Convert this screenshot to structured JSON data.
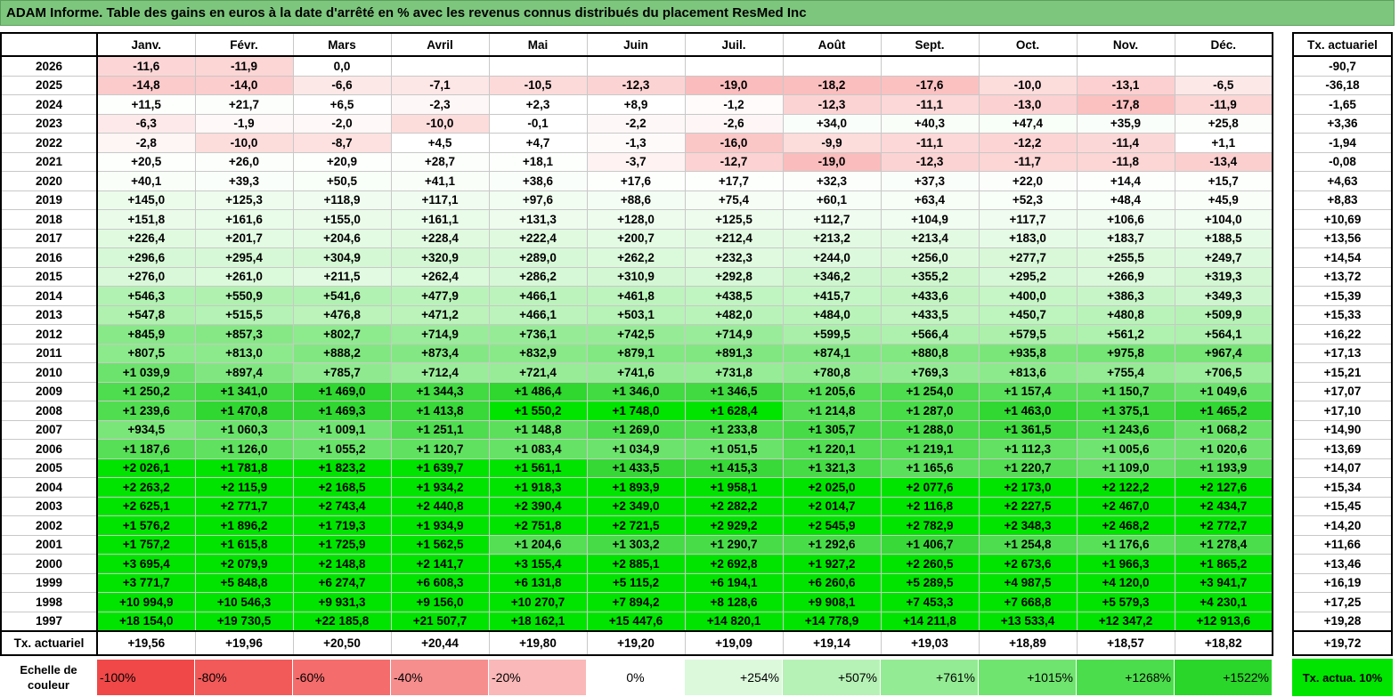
{
  "title": "ADAM Informe. Table des gains en euros à la date d'arrêté en % avec les revenus connus distribués du placement ResMed Inc",
  "months": [
    "Janv.",
    "Févr.",
    "Mars",
    "Avril",
    "Mai",
    "Juin",
    "Juil.",
    "Août",
    "Sept.",
    "Oct.",
    "Nov.",
    "Déc."
  ],
  "rate_header": "Tx. actuariel",
  "rows": [
    {
      "year": "2026",
      "values": [
        "-11,6",
        "-11,9",
        "0,0",
        "",
        "",
        "",
        "",
        "",
        "",
        "",
        "",
        ""
      ],
      "rate": "-90,7"
    },
    {
      "year": "2025",
      "values": [
        "-14,8",
        "-14,0",
        "-6,6",
        "-7,1",
        "-10,5",
        "-12,3",
        "-19,0",
        "-18,2",
        "-17,6",
        "-10,0",
        "-13,1",
        "-6,5"
      ],
      "rate": "-36,18"
    },
    {
      "year": "2024",
      "values": [
        "+11,5",
        "+21,7",
        "+6,5",
        "-2,3",
        "+2,3",
        "+8,9",
        "-1,2",
        "-12,3",
        "-11,1",
        "-13,0",
        "-17,8",
        "-11,9"
      ],
      "rate": "-1,65"
    },
    {
      "year": "2023",
      "values": [
        "-6,3",
        "-1,9",
        "-2,0",
        "-10,0",
        "-0,1",
        "-2,2",
        "-2,6",
        "+34,0",
        "+40,3",
        "+47,4",
        "+35,9",
        "+25,8"
      ],
      "rate": "+3,36"
    },
    {
      "year": "2022",
      "values": [
        "-2,8",
        "-10,0",
        "-8,7",
        "+4,5",
        "+4,7",
        "-1,3",
        "-16,0",
        "-9,9",
        "-11,1",
        "-12,2",
        "-11,4",
        "+1,1"
      ],
      "rate": "-1,94"
    },
    {
      "year": "2021",
      "values": [
        "+20,5",
        "+26,0",
        "+20,9",
        "+28,7",
        "+18,1",
        "-3,7",
        "-12,7",
        "-19,0",
        "-12,3",
        "-11,7",
        "-11,8",
        "-13,4"
      ],
      "rate": "-0,08"
    },
    {
      "year": "2020",
      "values": [
        "+40,1",
        "+39,3",
        "+50,5",
        "+41,1",
        "+38,6",
        "+17,6",
        "+17,7",
        "+32,3",
        "+37,3",
        "+22,0",
        "+14,4",
        "+15,7"
      ],
      "rate": "+4,63"
    },
    {
      "year": "2019",
      "values": [
        "+145,0",
        "+125,3",
        "+118,9",
        "+117,1",
        "+97,6",
        "+88,6",
        "+75,4",
        "+60,1",
        "+63,4",
        "+52,3",
        "+48,4",
        "+45,9"
      ],
      "rate": "+8,83"
    },
    {
      "year": "2018",
      "values": [
        "+151,8",
        "+161,6",
        "+155,0",
        "+161,1",
        "+131,3",
        "+128,0",
        "+125,5",
        "+112,7",
        "+104,9",
        "+117,7",
        "+106,6",
        "+104,0"
      ],
      "rate": "+10,69"
    },
    {
      "year": "2017",
      "values": [
        "+226,4",
        "+201,7",
        "+204,6",
        "+228,4",
        "+222,4",
        "+200,7",
        "+212,4",
        "+213,2",
        "+213,4",
        "+183,0",
        "+183,7",
        "+188,5"
      ],
      "rate": "+13,56"
    },
    {
      "year": "2016",
      "values": [
        "+296,6",
        "+295,4",
        "+304,9",
        "+320,9",
        "+289,0",
        "+262,2",
        "+232,3",
        "+244,0",
        "+256,0",
        "+277,7",
        "+255,5",
        "+249,7"
      ],
      "rate": "+14,54"
    },
    {
      "year": "2015",
      "values": [
        "+276,0",
        "+261,0",
        "+211,5",
        "+262,4",
        "+286,2",
        "+310,9",
        "+292,8",
        "+346,2",
        "+355,2",
        "+295,2",
        "+266,9",
        "+319,3"
      ],
      "rate": "+13,72"
    },
    {
      "year": "2014",
      "values": [
        "+546,3",
        "+550,9",
        "+541,6",
        "+477,9",
        "+466,1",
        "+461,8",
        "+438,5",
        "+415,7",
        "+433,6",
        "+400,0",
        "+386,3",
        "+349,3"
      ],
      "rate": "+15,39"
    },
    {
      "year": "2013",
      "values": [
        "+547,8",
        "+515,5",
        "+476,8",
        "+471,2",
        "+466,1",
        "+503,1",
        "+482,0",
        "+484,0",
        "+433,5",
        "+450,7",
        "+480,8",
        "+509,9"
      ],
      "rate": "+15,33"
    },
    {
      "year": "2012",
      "values": [
        "+845,9",
        "+857,3",
        "+802,7",
        "+714,9",
        "+736,1",
        "+742,5",
        "+714,9",
        "+599,5",
        "+566,4",
        "+579,5",
        "+561,2",
        "+564,1"
      ],
      "rate": "+16,22"
    },
    {
      "year": "2011",
      "values": [
        "+807,5",
        "+813,0",
        "+888,2",
        "+873,4",
        "+832,9",
        "+879,1",
        "+891,3",
        "+874,1",
        "+880,8",
        "+935,8",
        "+975,8",
        "+967,4"
      ],
      "rate": "+17,13"
    },
    {
      "year": "2010",
      "values": [
        "+1 039,9",
        "+897,4",
        "+785,7",
        "+712,4",
        "+721,4",
        "+741,6",
        "+731,8",
        "+780,8",
        "+769,3",
        "+813,6",
        "+755,4",
        "+706,5"
      ],
      "rate": "+15,21"
    },
    {
      "year": "2009",
      "values": [
        "+1 250,2",
        "+1 341,0",
        "+1 469,0",
        "+1 344,3",
        "+1 486,4",
        "+1 346,0",
        "+1 346,5",
        "+1 205,6",
        "+1 254,0",
        "+1 157,4",
        "+1 150,7",
        "+1 049,6"
      ],
      "rate": "+17,07"
    },
    {
      "year": "2008",
      "values": [
        "+1 239,6",
        "+1 470,8",
        "+1 469,3",
        "+1 413,8",
        "+1 550,2",
        "+1 748,0",
        "+1 628,4",
        "+1 214,8",
        "+1 287,0",
        "+1 463,0",
        "+1 375,1",
        "+1 465,2"
      ],
      "rate": "+17,10"
    },
    {
      "year": "2007",
      "values": [
        "+934,5",
        "+1 060,3",
        "+1 009,1",
        "+1 251,1",
        "+1 148,8",
        "+1 269,0",
        "+1 233,8",
        "+1 305,7",
        "+1 288,0",
        "+1 361,5",
        "+1 243,6",
        "+1 068,2"
      ],
      "rate": "+14,90"
    },
    {
      "year": "2006",
      "values": [
        "+1 187,6",
        "+1 126,0",
        "+1 055,2",
        "+1 120,7",
        "+1 083,4",
        "+1 034,9",
        "+1 051,5",
        "+1 220,1",
        "+1 219,1",
        "+1 112,3",
        "+1 005,6",
        "+1 020,6"
      ],
      "rate": "+13,69"
    },
    {
      "year": "2005",
      "values": [
        "+2 026,1",
        "+1 781,8",
        "+1 823,2",
        "+1 639,7",
        "+1 561,1",
        "+1 433,5",
        "+1 415,3",
        "+1 321,3",
        "+1 165,6",
        "+1 220,7",
        "+1 109,0",
        "+1 193,9"
      ],
      "rate": "+14,07"
    },
    {
      "year": "2004",
      "values": [
        "+2 263,2",
        "+2 115,9",
        "+2 168,5",
        "+1 934,2",
        "+1 918,3",
        "+1 893,9",
        "+1 958,1",
        "+2 025,0",
        "+2 077,6",
        "+2 173,0",
        "+2 122,2",
        "+2 127,6"
      ],
      "rate": "+15,34"
    },
    {
      "year": "2003",
      "values": [
        "+2 625,1",
        "+2 771,7",
        "+2 743,4",
        "+2 440,8",
        "+2 390,4",
        "+2 349,0",
        "+2 282,2",
        "+2 014,7",
        "+2 116,8",
        "+2 227,5",
        "+2 467,0",
        "+2 434,7"
      ],
      "rate": "+15,45"
    },
    {
      "year": "2002",
      "values": [
        "+1 576,2",
        "+1 896,2",
        "+1 719,3",
        "+1 934,9",
        "+2 751,8",
        "+2 721,5",
        "+2 929,2",
        "+2 545,9",
        "+2 782,9",
        "+2 348,3",
        "+2 468,2",
        "+2 772,7"
      ],
      "rate": "+14,20"
    },
    {
      "year": "2001",
      "values": [
        "+1 757,2",
        "+1 615,8",
        "+1 725,9",
        "+1 562,5",
        "+1 204,6",
        "+1 303,2",
        "+1 290,7",
        "+1 292,6",
        "+1 406,7",
        "+1 254,8",
        "+1 176,6",
        "+1 278,4"
      ],
      "rate": "+11,66"
    },
    {
      "year": "2000",
      "values": [
        "+3 695,4",
        "+2 079,9",
        "+2 148,8",
        "+2 141,7",
        "+3 155,4",
        "+2 885,1",
        "+2 692,8",
        "+1 927,2",
        "+2 260,5",
        "+2 673,6",
        "+1 966,3",
        "+1 865,2"
      ],
      "rate": "+13,46"
    },
    {
      "year": "1999",
      "values": [
        "+3 771,7",
        "+5 848,8",
        "+6 274,7",
        "+6 608,3",
        "+6 131,8",
        "+5 115,2",
        "+6 194,1",
        "+6 260,6",
        "+5 289,5",
        "+4 987,5",
        "+4 120,0",
        "+3 941,7"
      ],
      "rate": "+16,19"
    },
    {
      "year": "1998",
      "values": [
        "+10 994,9",
        "+10 546,3",
        "+9 931,3",
        "+9 156,0",
        "+10 270,7",
        "+7 894,2",
        "+8 128,6",
        "+9 908,1",
        "+7 453,3",
        "+7 668,8",
        "+5 579,3",
        "+4 230,1"
      ],
      "rate": "+17,25"
    },
    {
      "year": "1997",
      "values": [
        "+18 154,0",
        "+19 730,5",
        "+22 185,8",
        "+21 507,7",
        "+18 162,1",
        "+15 447,6",
        "+14 820,1",
        "+14 778,9",
        "+14 211,8",
        "+13 533,4",
        "+12 347,2",
        "+12 913,6"
      ],
      "rate": "+19,28"
    }
  ],
  "footer": {
    "label": "Tx. actuariel",
    "values": [
      "+19,56",
      "+19,96",
      "+20,50",
      "+20,44",
      "+19,80",
      "+19,20",
      "+19,09",
      "+19,14",
      "+19,03",
      "+18,89",
      "+18,57",
      "+18,82"
    ],
    "rate": "+19,72"
  },
  "scale": {
    "label": "Echelle de couleur",
    "steps": [
      {
        "text": "-100%",
        "color": "#f04848",
        "align": "neg"
      },
      {
        "text": "-80%",
        "color": "#f25a5a",
        "align": "neg"
      },
      {
        "text": "-60%",
        "color": "#f56c6c",
        "align": "neg"
      },
      {
        "text": "-40%",
        "color": "#f78e8e",
        "align": "neg"
      },
      {
        "text": "-20%",
        "color": "#fab8b8",
        "align": "neg"
      },
      {
        "text": "0%",
        "color": "#ffffff",
        "align": "mid"
      },
      {
        "text": "+254%",
        "color": "#dcf9dc",
        "align": "pos"
      },
      {
        "text": "+507%",
        "color": "#b6f2b6",
        "align": "pos"
      },
      {
        "text": "+761%",
        "color": "#93eb93",
        "align": "pos"
      },
      {
        "text": "+1015%",
        "color": "#6fe46f",
        "align": "pos"
      },
      {
        "text": "+1268%",
        "color": "#4cdd4c",
        "align": "pos"
      },
      {
        "text": "+1522%",
        "color": "#2ad62a",
        "align": "pos"
      }
    ],
    "tag": "Tx. actua. 10%",
    "tag_color": "#00e400"
  }
}
